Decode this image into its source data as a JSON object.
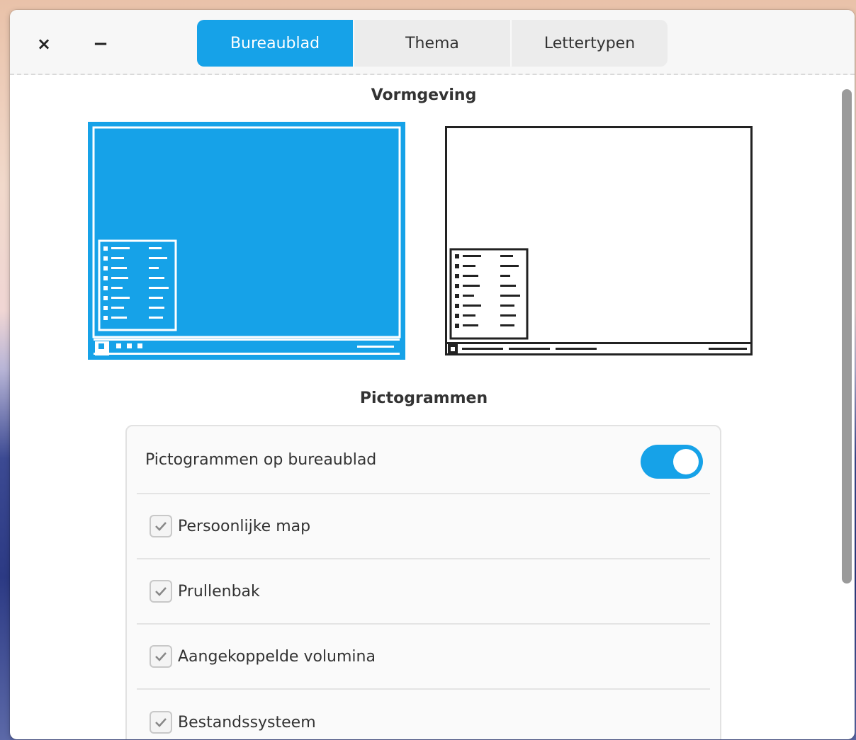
{
  "window": {
    "close_label": "×",
    "minimize_label": "−"
  },
  "tabs": [
    {
      "label": "Bureaublad",
      "active": true
    },
    {
      "label": "Thema",
      "active": false
    },
    {
      "label": "Lettertypen",
      "active": false
    }
  ],
  "sections": {
    "layout_title": "Vormgeving",
    "icons_title": "Pictogrammen"
  },
  "layout_options": [
    {
      "name": "bottom-panel-with-menu",
      "selected": true
    },
    {
      "name": "bottom-panel-light",
      "selected": false
    }
  ],
  "icons": {
    "toggle_label": "Pictogrammen op bureaublad",
    "toggle_on": true,
    "items": [
      {
        "label": "Persoonlijke map",
        "checked": true
      },
      {
        "label": "Prullenbak",
        "checked": true
      },
      {
        "label": "Aangekoppelde volumina",
        "checked": true
      },
      {
        "label": "Bestandssysteem",
        "checked": true
      }
    ]
  },
  "colors": {
    "accent": "#16a2e8",
    "text": "#333333"
  }
}
